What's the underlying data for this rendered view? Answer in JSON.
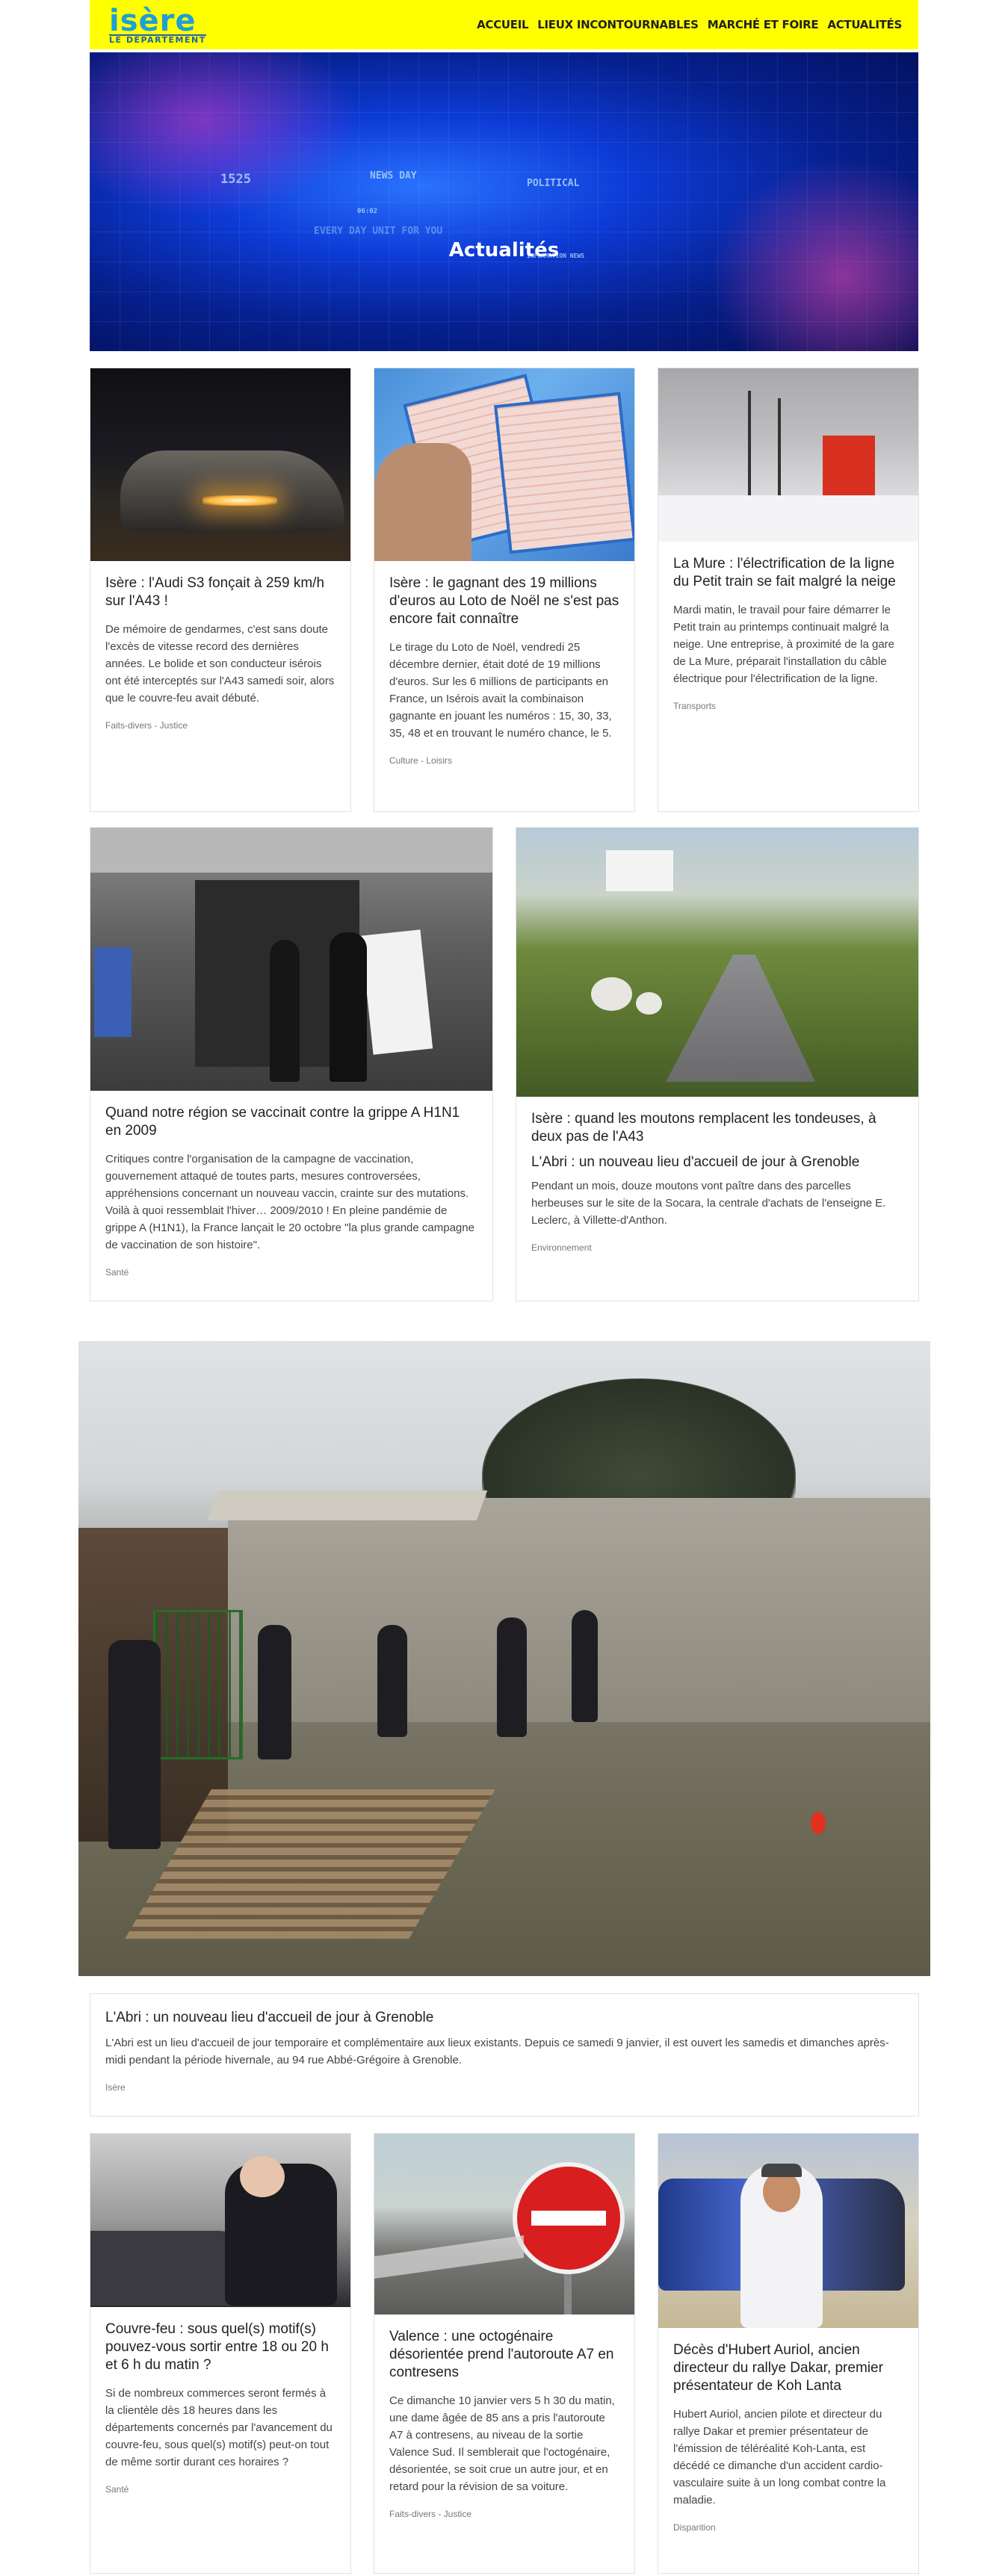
{
  "header": {
    "logo_top": "isère",
    "logo_bottom": "LE DÉPARTEMENT",
    "nav": [
      "ACCUEIL",
      "LIEUX INCONTOURNABLES",
      "MARCHÉ ET FOIRE",
      "ACTUALITÉS"
    ]
  },
  "hero": {
    "title": "Actualités",
    "deco_1525": "1525",
    "deco_newsday": "NEWS DAY",
    "deco_political": "POLITICAL",
    "deco_time": "06:02",
    "deco_everyday": "EVERY DAY UNIT FOR YOU",
    "deco_info": "INFORMATION NEWS"
  },
  "articles_row1": [
    {
      "title": "Isère : l'Audi S3 fonçait à 259 km/h sur l'A43 !",
      "excerpt": "De mémoire de gendarmes, c'est sans doute l'excès de vitesse record des dernières années. Le bolide et son conducteur isérois ont été interceptés sur l'A43 samedi soir, alors que le couvre-feu avait débuté.",
      "category": "Faits-divers - Justice"
    },
    {
      "title": "Isère : le gagnant des 19 millions d'euros au Loto de Noël ne s'est pas encore fait connaître",
      "excerpt": "Le tirage du Loto de Noël, vendredi 25 décembre dernier, était doté de 19 millions d'euros. Sur les 6 millions de participants en France, un Isérois avait la combinaison gagnante en jouant les numéros : 15, 30, 33, 35, 48 et en trouvant le numéro chance, le 5.",
      "category": "Culture - Loisirs"
    },
    {
      "title": "La Mure : l'électrification de la ligne du Petit train se fait malgré la neige",
      "excerpt": "Mardi matin, le travail pour faire démarrer le Petit train au printemps continuait malgré la neige. Une entreprise, à proximité de la gare de La Mure, préparait l'installation du câble électrique pour l'électrification de la ligne.",
      "category": "Transports"
    }
  ],
  "articles_row2": [
    {
      "title": "Quand notre région se vaccinait contre la grippe A H1N1 en 2009",
      "excerpt": "Critiques contre l'organisation de la campagne de vaccination, gouvernement attaqué de toutes parts, mesures controversées, appréhensions concernant un nouveau vaccin, crainte sur des mutations. Voilà à quoi ressemblait l'hiver… 2009/2010 ! En pleine pandémie de grippe A (H1N1), la France lançait le 20 octobre \"la plus grande campagne de vaccination de son histoire\".",
      "category": "Santé"
    },
    {
      "title": "Isère : quand les moutons remplacent les tondeuses, à deux pas de l'A43",
      "subtitle": "L'Abri : un nouveau lieu d'accueil de jour à Grenoble",
      "excerpt": "Pendant un mois, douze moutons vont paître dans des parcelles herbeuses sur le site de la Socara, la centrale d'achats de l'enseigne E. Leclerc, à Villette-d'Anthon.",
      "category": "Environnement"
    }
  ],
  "feature": {
    "title": "L'Abri : un nouveau lieu d'accueil de jour à Grenoble",
    "excerpt": "L'Abri est un lieu d'accueil de jour temporaire et complémentaire aux lieux existants. Depuis ce samedi 9 janvier, il est ouvert les samedis et dimanches après-midi pendant la période hivernale, au 94 rue Abbé-Grégoire à Grenoble.",
    "category": "Isère"
  },
  "articles_row3": [
    {
      "title": "Couvre-feu : sous quel(s) motif(s) pouvez-vous sortir entre 18 ou 20 h et 6 h du matin ?",
      "excerpt": "Si de nombreux commerces seront fermés à la clientèle dès 18 heures dans les départements concernés par l'avancement du couvre-feu, sous quel(s) motif(s) peut-on tout de même sortir durant ces horaires ?",
      "category": "Santé"
    },
    {
      "title": "Valence : une octogénaire désorientée prend l'autoroute A7 en contresens",
      "excerpt": "Ce dimanche 10 janvier vers 5 h 30 du matin, une dame âgée de 85 ans a pris l'autoroute A7 à contresens, au niveau de la sortie Valence Sud. Il semblerait que l'octogénaire, désorientée, se soit crue un autre jour, et en retard pour la révision de sa voiture.",
      "category": "Faits-divers - Justice"
    },
    {
      "title": "Décès d'Hubert Auriol, ancien directeur du rallye Dakar, premier présentateur de Koh Lanta",
      "excerpt": "Hubert Auriol, ancien pilote et directeur du rallye Dakar et premier présentateur de l'émission de téléréalité Koh-Lanta, est décédé ce dimanche d'un accident cardio-vasculaire suite à un long combat contre la maladie.",
      "category": "Disparition"
    }
  ]
}
